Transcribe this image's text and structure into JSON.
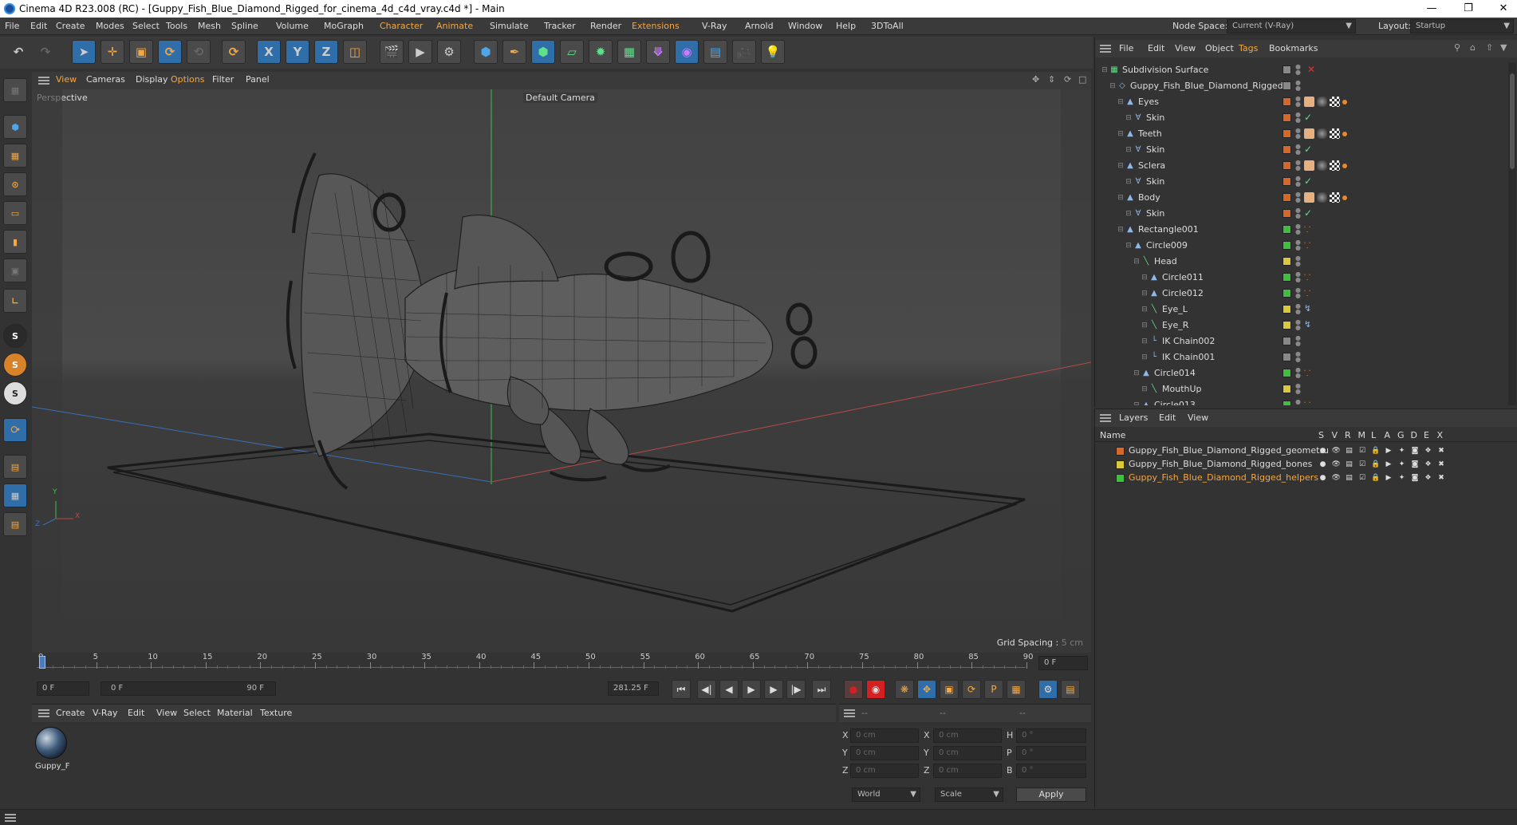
{
  "window": {
    "title": "Cinema 4D R23.008 (RC) - [Guppy_Fish_Blue_Diamond_Rigged_for_cinema_4d_c4d_vray.c4d *] - Main",
    "min_icon": "minimize-icon",
    "max_icon": "restore-icon",
    "close_icon": "close-icon"
  },
  "menubar": {
    "items": [
      "File",
      "Edit",
      "Create",
      "Modes",
      "Select",
      "Tools",
      "Mesh",
      "Spline",
      "Volume",
      "MoGraph",
      "Character",
      "Animate",
      "Simulate",
      "Tracker",
      "Render",
      "Extensions",
      "V-Ray",
      "Arnold",
      "Window",
      "Help",
      "3DToAll"
    ],
    "node_space_label": "Node Space:",
    "node_space_value": "Current (V-Ray)",
    "layout_label": "Layout:",
    "layout_value": "Startup"
  },
  "viewport": {
    "menu": [
      "View",
      "Cameras",
      "Display",
      "Options",
      "Filter",
      "Panel"
    ],
    "label": "Perspective",
    "camera": "Default Camera",
    "grid_spacing": "Grid Spacing : 5 cm",
    "axis_y": "Y",
    "axis_x": "X",
    "axis_z": "Z"
  },
  "timeline": {
    "ticks": [
      "0",
      "5",
      "10",
      "15",
      "20",
      "25",
      "30",
      "35",
      "40",
      "45",
      "50",
      "55",
      "60",
      "65",
      "70",
      "75",
      "80",
      "85",
      "90"
    ],
    "current_frame": "0 F"
  },
  "transport": {
    "start_frame": "0 F",
    "range_start": "0 F",
    "range_end": "90 F",
    "fps_field": "281.25 F"
  },
  "material_manager": {
    "menu": [
      "Create",
      "V-Ray",
      "Edit",
      "View",
      "Select",
      "Material",
      "Texture"
    ],
    "materials": [
      {
        "name": "Guppy_F"
      }
    ]
  },
  "attributes": {
    "headers": [
      "--",
      "--",
      "--"
    ],
    "rows": [
      {
        "a": "X",
        "av": "0 cm",
        "b": "X",
        "bv": "0 cm",
        "c": "H",
        "cv": "0 °"
      },
      {
        "a": "Y",
        "av": "0 cm",
        "b": "Y",
        "bv": "0 cm",
        "c": "P",
        "cv": "0 °"
      },
      {
        "a": "Z",
        "av": "0 cm",
        "b": "Z",
        "bv": "0 cm",
        "c": "B",
        "cv": "0 °"
      }
    ],
    "coord_mode": "World",
    "size_mode": "Scale",
    "apply": "Apply"
  },
  "object_manager": {
    "menu": [
      "File",
      "Edit",
      "View",
      "Object",
      "Tags",
      "Bookmarks"
    ],
    "objects": [
      {
        "name": "Subdivision Surface",
        "depth": 0,
        "color": "#888888",
        "icon": "subdivision-icon",
        "tags": ""
      },
      {
        "name": "Guppy_Fish_Blue_Diamond_Rigged",
        "depth": 1,
        "color": "#888888",
        "icon": "null-icon",
        "tags": ""
      },
      {
        "name": "Eyes",
        "depth": 2,
        "color": "#d8672a",
        "icon": "polygon-object-icon",
        "tags": "mat"
      },
      {
        "name": "Skin",
        "depth": 3,
        "color": "#d8672a",
        "icon": "skin-icon",
        "tags": "check"
      },
      {
        "name": "Teeth",
        "depth": 2,
        "color": "#d8672a",
        "icon": "polygon-object-icon",
        "tags": "mat"
      },
      {
        "name": "Skin",
        "depth": 3,
        "color": "#d8672a",
        "icon": "skin-icon",
        "tags": "check"
      },
      {
        "name": "Sclera",
        "depth": 2,
        "color": "#d8672a",
        "icon": "polygon-object-icon",
        "tags": "mat"
      },
      {
        "name": "Skin",
        "depth": 3,
        "color": "#d8672a",
        "icon": "skin-icon",
        "tags": "check"
      },
      {
        "name": "Body",
        "depth": 2,
        "color": "#d8672a",
        "icon": "polygon-object-icon",
        "tags": "mat"
      },
      {
        "name": "Skin",
        "depth": 3,
        "color": "#d8672a",
        "icon": "skin-icon",
        "tags": "check"
      },
      {
        "name": "Rectangle001",
        "depth": 2,
        "color": "#3fbf3f",
        "icon": "spline-icon",
        "tags": "dots"
      },
      {
        "name": "Circle009",
        "depth": 3,
        "color": "#3fbf3f",
        "icon": "spline-icon",
        "tags": "dots"
      },
      {
        "name": "Head",
        "depth": 4,
        "color": "#d8c83a",
        "icon": "joint-icon",
        "tags": ""
      },
      {
        "name": "Circle011",
        "depth": 5,
        "color": "#3fbf3f",
        "icon": "spline-icon",
        "tags": "dots"
      },
      {
        "name": "Circle012",
        "depth": 5,
        "color": "#3fbf3f",
        "icon": "spline-icon",
        "tags": "dots"
      },
      {
        "name": "Eye_L",
        "depth": 5,
        "color": "#d8c83a",
        "icon": "joint-icon",
        "tags": "ik"
      },
      {
        "name": "Eye_R",
        "depth": 5,
        "color": "#d8c83a",
        "icon": "joint-icon",
        "tags": "ik"
      },
      {
        "name": "IK Chain002",
        "depth": 5,
        "color": "#888888",
        "icon": "ik-chain-icon",
        "tags": ""
      },
      {
        "name": "IK Chain001",
        "depth": 5,
        "color": "#888888",
        "icon": "ik-chain-icon",
        "tags": ""
      },
      {
        "name": "Circle014",
        "depth": 4,
        "color": "#3fbf3f",
        "icon": "spline-icon",
        "tags": "dots"
      },
      {
        "name": "MouthUp",
        "depth": 5,
        "color": "#d8c83a",
        "icon": "joint-icon",
        "tags": ""
      },
      {
        "name": "Circle013",
        "depth": 4,
        "color": "#3fbf3f",
        "icon": "spline-icon",
        "tags": "dots"
      }
    ]
  },
  "layer_manager": {
    "menu": [
      "Layers",
      "Edit",
      "View"
    ],
    "name_header": "Name",
    "flags": [
      "S",
      "V",
      "R",
      "M",
      "L",
      "A",
      "G",
      "D",
      "E",
      "X"
    ],
    "layers": [
      {
        "name": "Guppy_Fish_Blue_Diamond_Rigged_geometru",
        "color": "#d8672a",
        "highlight": false
      },
      {
        "name": "Guppy_Fish_Blue_Diamond_Rigged_bones",
        "color": "#d8c83a",
        "highlight": false
      },
      {
        "name": "Guppy_Fish_Blue_Diamond_Rigged_helpers",
        "color": "#3fbf3f",
        "highlight": true
      }
    ]
  },
  "colors": {
    "accent": "#f5a742",
    "active_tool": "#2f6ea8",
    "record": "#d42020"
  }
}
